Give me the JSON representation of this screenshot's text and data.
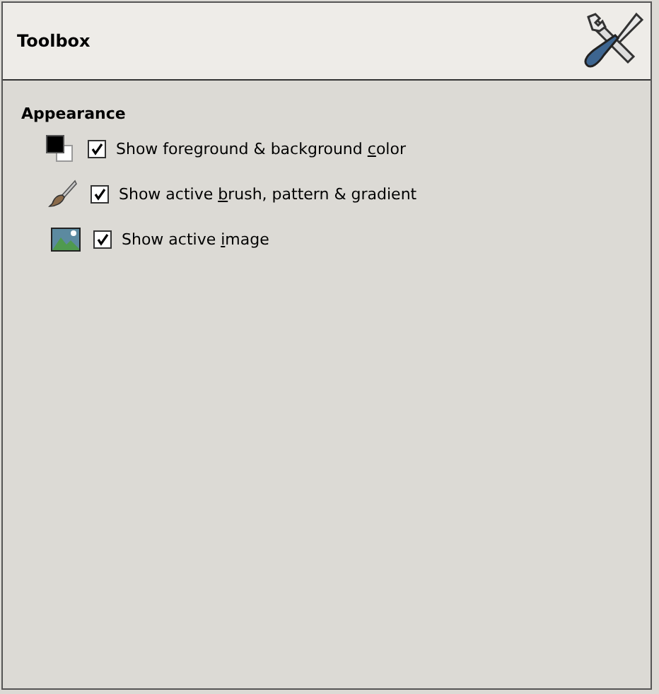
{
  "header": {
    "title": "Toolbox"
  },
  "section": {
    "title": "Appearance"
  },
  "options": [
    {
      "kind": "colors",
      "checked": true,
      "label": {
        "before": "Show foreground & background ",
        "key": "c",
        "after": "olor"
      }
    },
    {
      "kind": "brush",
      "checked": true,
      "label": {
        "before": "Show active ",
        "key": "b",
        "after": "rush, pattern & gradient"
      }
    },
    {
      "kind": "image",
      "checked": true,
      "label": {
        "before": "Show active ",
        "key": "i",
        "after": "mage"
      }
    }
  ]
}
